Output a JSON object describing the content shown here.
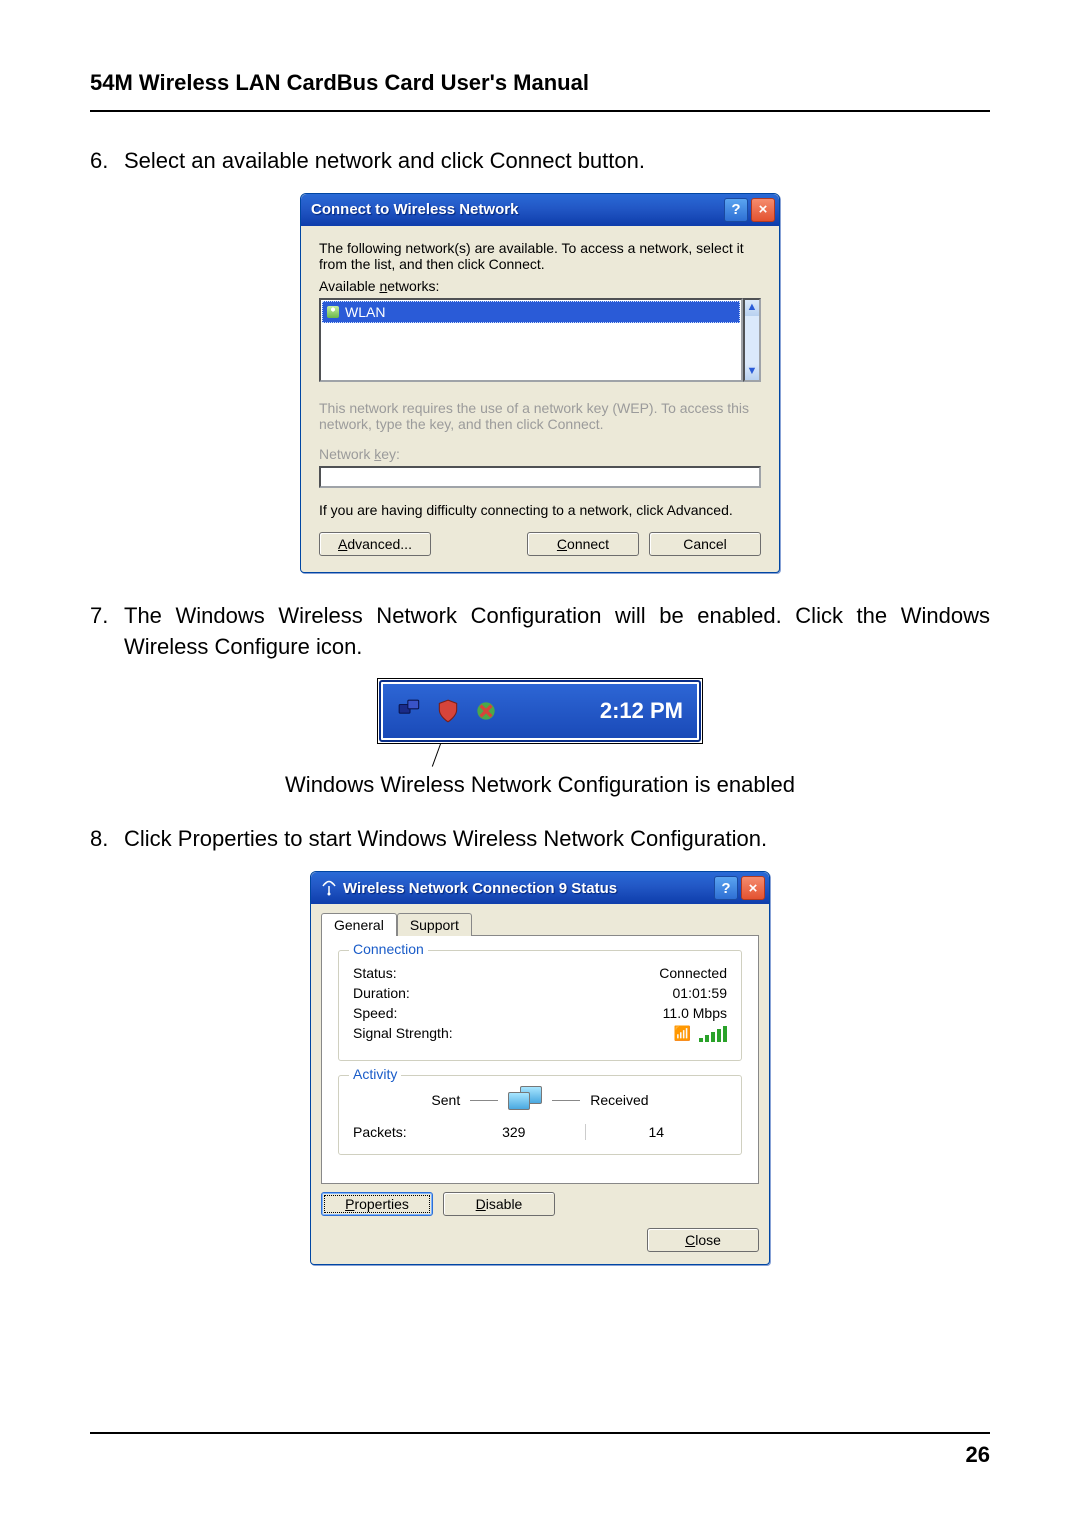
{
  "doc": {
    "title": "54M Wireless LAN CardBus Card User's Manual",
    "page_number": "26",
    "steps": {
      "s6": {
        "num": "6.",
        "text": "Select an available network and click Connect button."
      },
      "s7": {
        "num": "7.",
        "text": "The Windows Wireless Network Configuration will be enabled. Click the Windows Wireless Configure icon."
      },
      "s8": {
        "num": "8.",
        "text": "Click Properties to start Windows Wireless Network Configuration."
      }
    },
    "tray_caption": "Windows Wireless Network Configuration is enabled",
    "tray_time": "2:12 PM"
  },
  "dialog1": {
    "title": "Connect to Wireless Network",
    "intro": "The following network(s) are available. To access a network, select it from the list, and then click Connect.",
    "available_label_pre": "Available ",
    "available_label_u": "n",
    "available_label_post": "etworks:",
    "list_item": "WLAN",
    "req_text": "This network requires the use of a network key (WEP). To access this network, type the key, and then click Connect.",
    "key_label_pre": "Network ",
    "key_label_u": "k",
    "key_label_post": "ey:",
    "difficulty": "If you are having difficulty connecting to a network, click Advanced.",
    "buttons": {
      "advanced_u": "A",
      "advanced_post": "dvanced...",
      "connect_u": "C",
      "connect_post": "onnect",
      "cancel": "Cancel"
    }
  },
  "dialog2": {
    "title": "Wireless Network Connection 9 Status",
    "tabs": {
      "general": "General",
      "support": "Support"
    },
    "connection": {
      "legend": "Connection",
      "status_l": "Status:",
      "status_v": "Connected",
      "duration_l": "Duration:",
      "duration_v": "01:01:59",
      "speed_l": "Speed:",
      "speed_v": "11.0 Mbps",
      "signal_l": "Signal Strength:"
    },
    "activity": {
      "legend": "Activity",
      "sent": "Sent",
      "received": "Received",
      "packets_l": "Packets:",
      "packets_sent": "329",
      "packets_recv": "14"
    },
    "buttons": {
      "properties_u": "P",
      "properties_post": "roperties",
      "disable_u": "D",
      "disable_post": "isable",
      "close_u": "C",
      "close_post": "lose"
    }
  }
}
